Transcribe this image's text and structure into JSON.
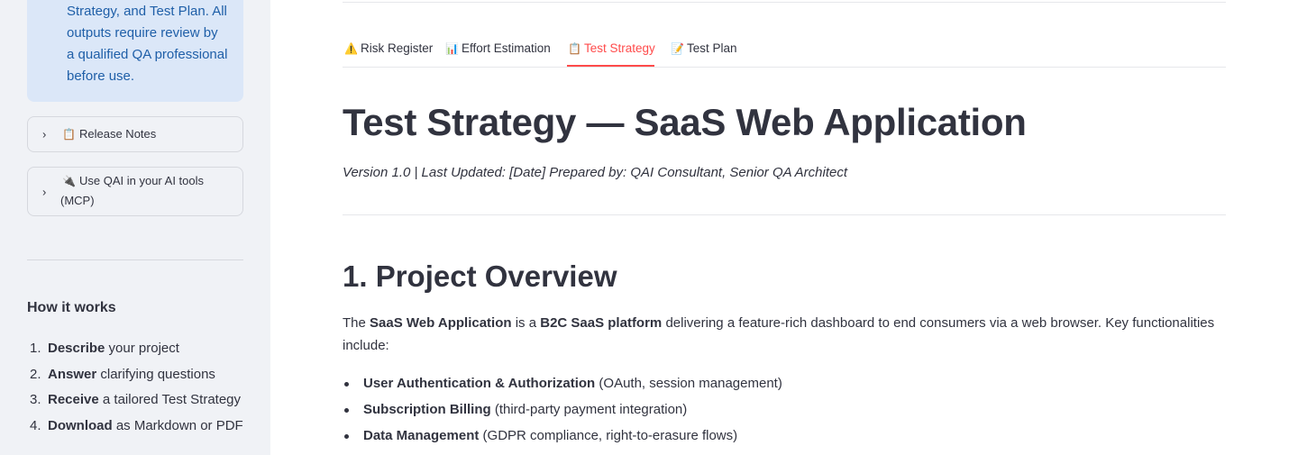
{
  "sidebar": {
    "info_lines": [
      "Strategy, and Test Plan. All",
      "outputs require review by",
      "a qualified QA professional",
      "before use."
    ],
    "expanders": [
      {
        "icon": "📋",
        "label": "Release Notes"
      },
      {
        "icon": "🔌",
        "label": "Use QAI in your AI tools",
        "label_cont": "(MCP)"
      }
    ],
    "how_title": "How it works",
    "steps": [
      {
        "num": "1.",
        "bold": "Describe",
        "rest": " your project"
      },
      {
        "num": "2.",
        "bold": "Answer",
        "rest": " clarifying questions"
      },
      {
        "num": "3.",
        "bold": "Receive",
        "rest": " a tailored Test Strategy"
      },
      {
        "num": "4.",
        "bold": "Download",
        "rest": " as Markdown or PDF"
      }
    ]
  },
  "tabs": [
    {
      "icon": "⚠️",
      "label": "Risk Register",
      "active": false
    },
    {
      "icon": "📊",
      "label": "Effort Estimation",
      "active": false
    },
    {
      "icon": "📋",
      "label": "Test Strategy",
      "active": true
    },
    {
      "icon": "📝",
      "label": "Test Plan",
      "active": false
    }
  ],
  "doc": {
    "title": "Test Strategy — SaaS Web Application",
    "meta": "Version 1.0 | Last Updated: [Date] Prepared by: QAI Consultant, Senior QA Architect",
    "section1_title": "1. Project Overview",
    "para_prefix": "The ",
    "para_bold1": "SaaS Web Application",
    "para_mid": " is a ",
    "para_bold2": "B2C SaaS platform",
    "para_suffix": " delivering a feature-rich dashboard to end consumers via a web browser. Key functionalities include:",
    "bullets": [
      {
        "bold": "User Authentication & Authorization",
        "rest": " (OAuth, session management)"
      },
      {
        "bold": "Subscription Billing",
        "rest": " (third-party payment integration)"
      },
      {
        "bold": "Data Management",
        "rest": " (GDPR compliance, right-to-erasure flows)"
      }
    ]
  },
  "colors": {
    "accent": "#ff4b4b",
    "info_bg": "#dbe7f8",
    "info_text": "#1f5fa8",
    "sidebar_bg": "#f0f2f6"
  }
}
